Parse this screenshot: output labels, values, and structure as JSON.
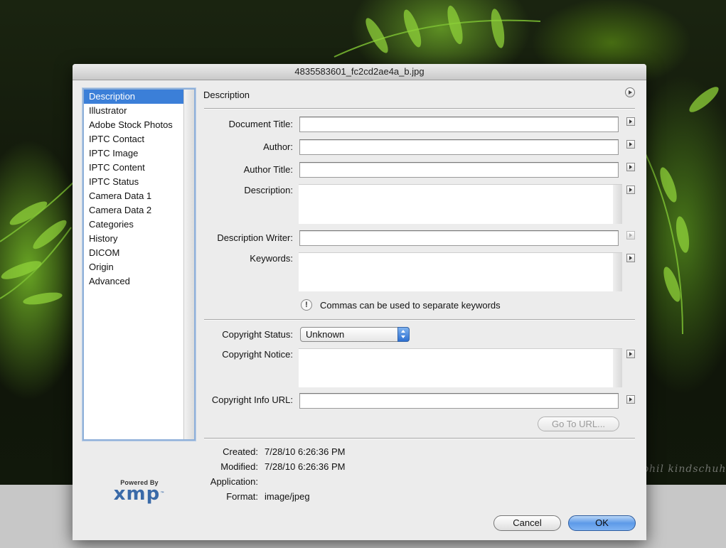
{
  "window": {
    "title": "4835583601_fc2cd2ae4a_b.jpg"
  },
  "background": {
    "watermark": "phil kindschuh"
  },
  "sidebar": {
    "items": [
      {
        "label": "Description",
        "selected": true
      },
      {
        "label": "Illustrator"
      },
      {
        "label": "Adobe Stock Photos"
      },
      {
        "label": "IPTC Contact"
      },
      {
        "label": "IPTC Image"
      },
      {
        "label": "IPTC Content"
      },
      {
        "label": "IPTC Status"
      },
      {
        "label": "Camera Data 1"
      },
      {
        "label": "Camera Data 2"
      },
      {
        "label": "Categories"
      },
      {
        "label": "History"
      },
      {
        "label": "DICOM"
      },
      {
        "label": "Origin"
      },
      {
        "label": "Advanced"
      }
    ]
  },
  "logo": {
    "powered_by": "Powered By",
    "name": "xmp",
    "tm": "™"
  },
  "pane": {
    "title": "Description",
    "fields": {
      "document_title": {
        "label": "Document Title:",
        "value": ""
      },
      "author": {
        "label": "Author:",
        "value": ""
      },
      "author_title": {
        "label": "Author Title:",
        "value": ""
      },
      "description": {
        "label": "Description:",
        "value": ""
      },
      "description_writer": {
        "label": "Description Writer:",
        "value": ""
      },
      "keywords": {
        "label": "Keywords:",
        "value": ""
      },
      "keywords_hint": "Commas can be used to separate keywords",
      "copyright_status": {
        "label": "Copyright Status:",
        "value": "Unknown"
      },
      "copyright_notice": {
        "label": "Copyright Notice:",
        "value": ""
      },
      "copyright_info_url": {
        "label": "Copyright Info URL:",
        "value": ""
      }
    },
    "goto_url_label": "Go To URL...",
    "metadata": {
      "created": {
        "label": "Created:",
        "value": "7/28/10 6:26:36 PM"
      },
      "modified": {
        "label": "Modified:",
        "value": "7/28/10 6:26:36 PM"
      },
      "application": {
        "label": "Application:",
        "value": ""
      },
      "format": {
        "label": "Format:",
        "value": "image/jpeg"
      }
    }
  },
  "buttons": {
    "cancel": "Cancel",
    "ok": "OK"
  },
  "colors": {
    "selection": "#3b7fd8",
    "accent_button": "#5d9ae8",
    "xmp_blue": "#3a6aa8"
  }
}
